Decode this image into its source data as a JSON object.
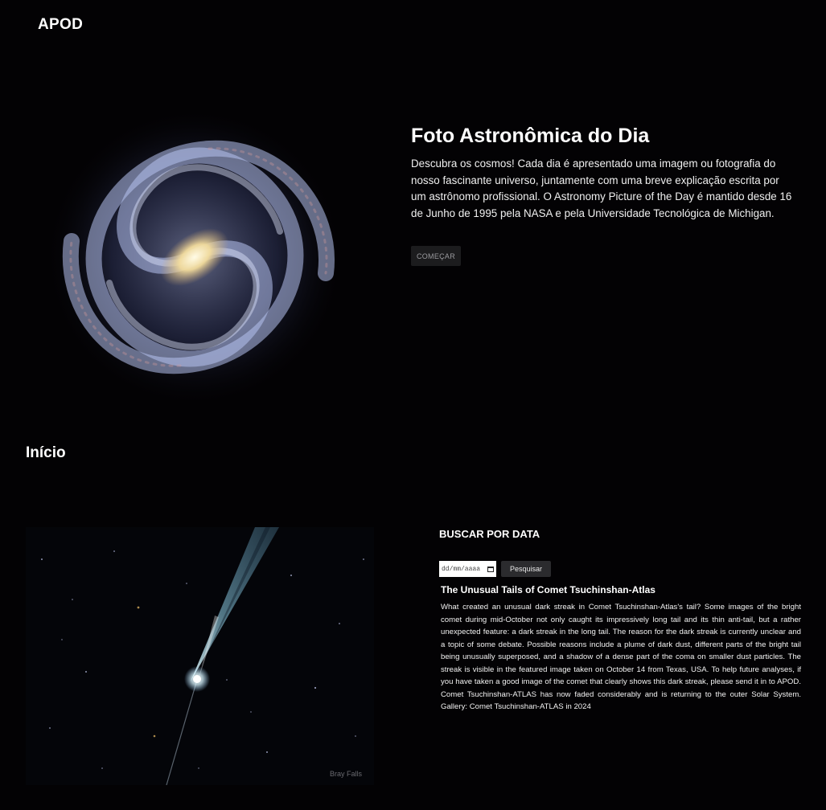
{
  "header": {
    "brand": "APOD"
  },
  "hero": {
    "title": "Foto Astronômica do Dia",
    "description": "Descubra os cosmos! Cada dia é apresentado uma imagem ou fotografia do nosso fascinante universo, juntamente com uma breve explicação escrita por um astrônomo profissional. O Astronomy Picture of the Day é mantido desde 16 de Junho de 1995 pela NASA e pela Universidade Tecnológica de Michigan.",
    "button_label": "COMEÇAR"
  },
  "section": {
    "title": "Início"
  },
  "search": {
    "title": "BUSCAR POR DATA",
    "date_placeholder": "dd/mm/aaaa",
    "button_label": "Pesquisar"
  },
  "apod": {
    "title": "The Unusual Tails of Comet Tsuchinshan-Atlas",
    "explanation": "What created an unusual dark streak in Comet Tsuchinshan-Atlas's tail? Some images of the bright comet during mid-October not only caught its impressively long tail and its thin anti-tail, but a rather unexpected feature: a dark streak in the long tail. The reason for the dark streak is currently unclear and a topic of some debate. Possible reasons include a plume of dark dust, different parts of the bright tail being unusually superposed, and a shadow of a dense part of the coma on smaller dust particles. The streak is visible in the featured image taken on October 14 from Texas, USA. To help future analyses, if you have taken a good image of the comet that clearly shows this dark streak, please send it in to APOD. Comet Tsuchinshan-ATLAS has now faded considerably and is returning to the outer Solar System. Gallery: Comet Tsuchinshan-ATLAS in 2024",
    "image_credit": "Bray Falls"
  },
  "colors": {
    "background": "#030204",
    "button_bg": "#1c1c1e",
    "search_button_bg": "#2b2b2e"
  },
  "icons": {
    "date_picker": "calendar-icon"
  }
}
